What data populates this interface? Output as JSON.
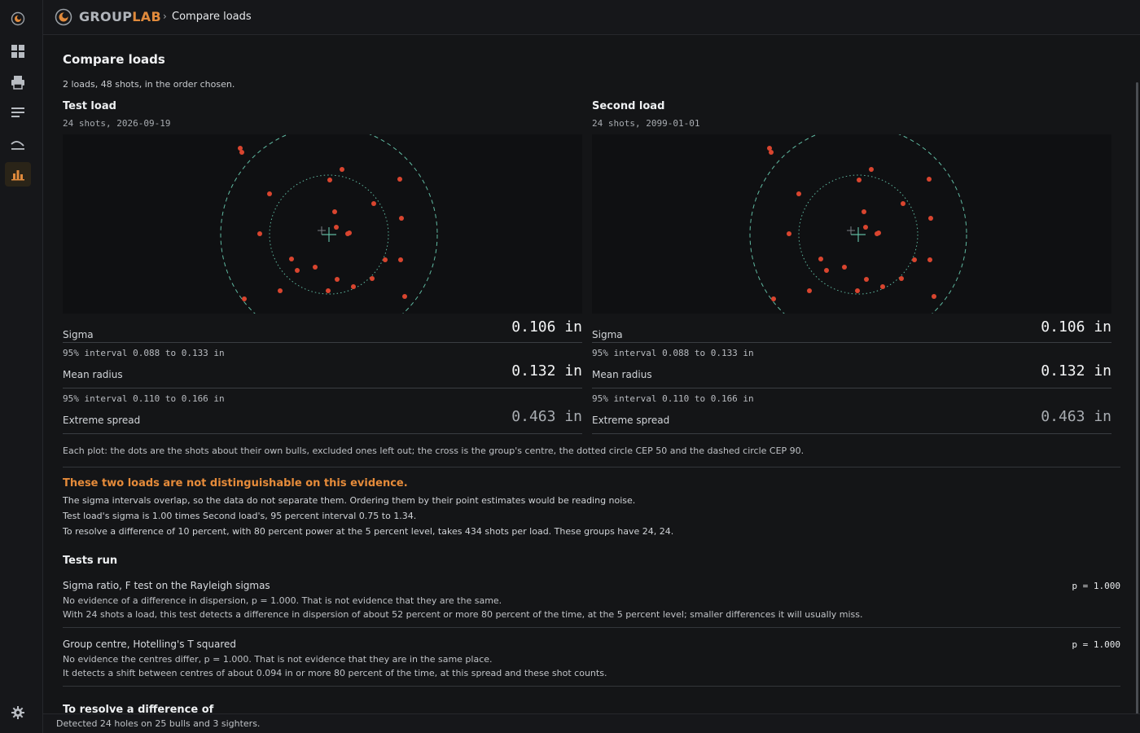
{
  "app": {
    "brand_prefix": "GROUP",
    "brand_suffix": "LAB",
    "breadcrumb_sep": "›",
    "breadcrumb": "Compare loads"
  },
  "sidebar": {
    "items": [
      {
        "icon": "logo-icon"
      },
      {
        "icon": "dashboard-icon"
      },
      {
        "icon": "printer-icon"
      },
      {
        "icon": "list-icon"
      },
      {
        "icon": "arc-icon"
      },
      {
        "icon": "bar-chart-icon",
        "active": true
      }
    ],
    "footer_icon": "gear-icon"
  },
  "page": {
    "title": "Compare loads",
    "subtitle": "2 loads, 48 shots, in the order chosen."
  },
  "loads": [
    {
      "name": "Test load",
      "meta": "24 shots, 2026-09-19",
      "stats": {
        "sigma_label": "Sigma",
        "sigma_value": "0.106 in",
        "sigma_interval": "95% interval 0.088 to 0.133 in",
        "mean_radius_label": "Mean radius",
        "mean_radius_value": "0.132 in",
        "mean_radius_interval": "95% interval 0.110 to 0.166 in",
        "extreme_spread_label": "Extreme spread",
        "extreme_spread_value": "0.463 in"
      }
    },
    {
      "name": "Second load",
      "meta": "24 shots, 2099-01-01",
      "stats": {
        "sigma_label": "Sigma",
        "sigma_value": "0.106 in",
        "sigma_interval": "95% interval 0.088 to 0.133 in",
        "mean_radius_label": "Mean radius",
        "mean_radius_value": "0.132 in",
        "mean_radius_interval": "95% interval 0.110 to 0.166 in",
        "extreme_spread_label": "Extreme spread",
        "extreme_spread_value": "0.463 in"
      }
    }
  ],
  "caption": "Each plot: the dots are the shots about their own bulls, excluded ones left out; the cross is the group's centre, the dotted circle CEP 50 and the dashed circle CEP 90.",
  "verdict": {
    "title": "These two loads are not distinguishable on this evidence.",
    "lines": [
      "The sigma intervals overlap, so the data do not separate them. Ordering them by their point estimates would be reading noise.",
      "Test load's sigma is 1.00 times Second load's, 95 percent interval 0.75 to 1.34.",
      "To resolve a difference of 10 percent, with 80 percent power at the 5 percent level, takes 434 shots per load. These groups have 24, 24."
    ]
  },
  "tests": {
    "title": "Tests run",
    "items": [
      {
        "name": "Sigma ratio, F test on the Rayleigh sigmas",
        "p": "p = 1.000",
        "line1": "No evidence of a difference in dispersion, p = 1.000. That is not evidence that they are the same.",
        "line2": "With 24 shots a load, this test detects a difference in dispersion of about 52 percent or more 80 percent of the time, at the 5 percent level; smaller differences it will usually miss."
      },
      {
        "name": "Group centre, Hotelling's T squared",
        "p": "p = 1.000",
        "line1": "No evidence the centres differ, p = 1.000. That is not evidence that they are in the same place.",
        "line2": "It detects a shift between centres of about 0.094 in or more 80 percent of the time, at this spread and these shot counts."
      }
    ],
    "next_title": "To resolve a difference of"
  },
  "status": "Detected 24 holes on 25 bulls and 3 sighters.",
  "colors": {
    "accent": "#e08a3c",
    "shot": "#d9452f",
    "cep": "#5fb8a0",
    "background": "#141517"
  }
}
